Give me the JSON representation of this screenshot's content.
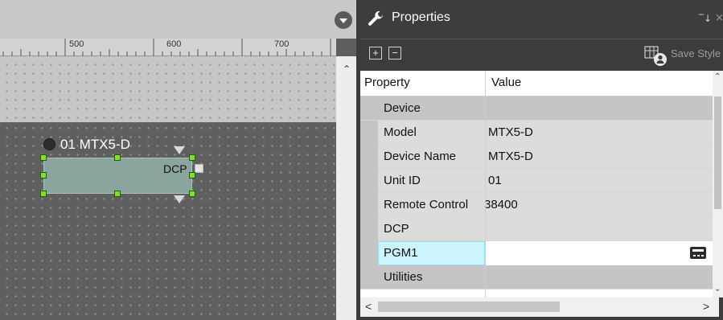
{
  "canvas": {
    "ruler_labels": [
      "500",
      "600",
      "700"
    ],
    "device": {
      "title": "01 MTX5-D",
      "port_label": "DCP"
    }
  },
  "properties": {
    "title": "Properties",
    "toolbar": {
      "expand_label": "+",
      "collapse_label": "−",
      "save_style_label": "Save Style"
    },
    "columns": {
      "property": "Property",
      "value": "Value"
    },
    "rows": [
      {
        "type": "category",
        "label": "Device",
        "value": ""
      },
      {
        "type": "property",
        "label": "Model",
        "value": "MTX5-D"
      },
      {
        "type": "property",
        "label": "Device Name",
        "value": "MTX5-D"
      },
      {
        "type": "property",
        "label": "Unit ID",
        "value": "01"
      },
      {
        "type": "property",
        "label": "Remote Control",
        "value": "38400"
      },
      {
        "type": "property",
        "label": "DCP",
        "value": ""
      },
      {
        "type": "property",
        "label": "PGM1",
        "value": "",
        "selected": true
      },
      {
        "type": "category",
        "label": "Utilities",
        "value": ""
      }
    ],
    "scroll": {
      "left_arrow": "<",
      "right_arrow": ">"
    }
  },
  "colors": {
    "handle": "#7fe02a",
    "device_body": "#8aa59e",
    "selected_cell": "#ccf5ff",
    "panel_dark": "#3c3c3c"
  },
  "icons": [
    "collapse-chevron-icon",
    "wrench-icon",
    "pin-icon",
    "close-icon",
    "save-style-icon",
    "ellipsis-icon"
  ]
}
